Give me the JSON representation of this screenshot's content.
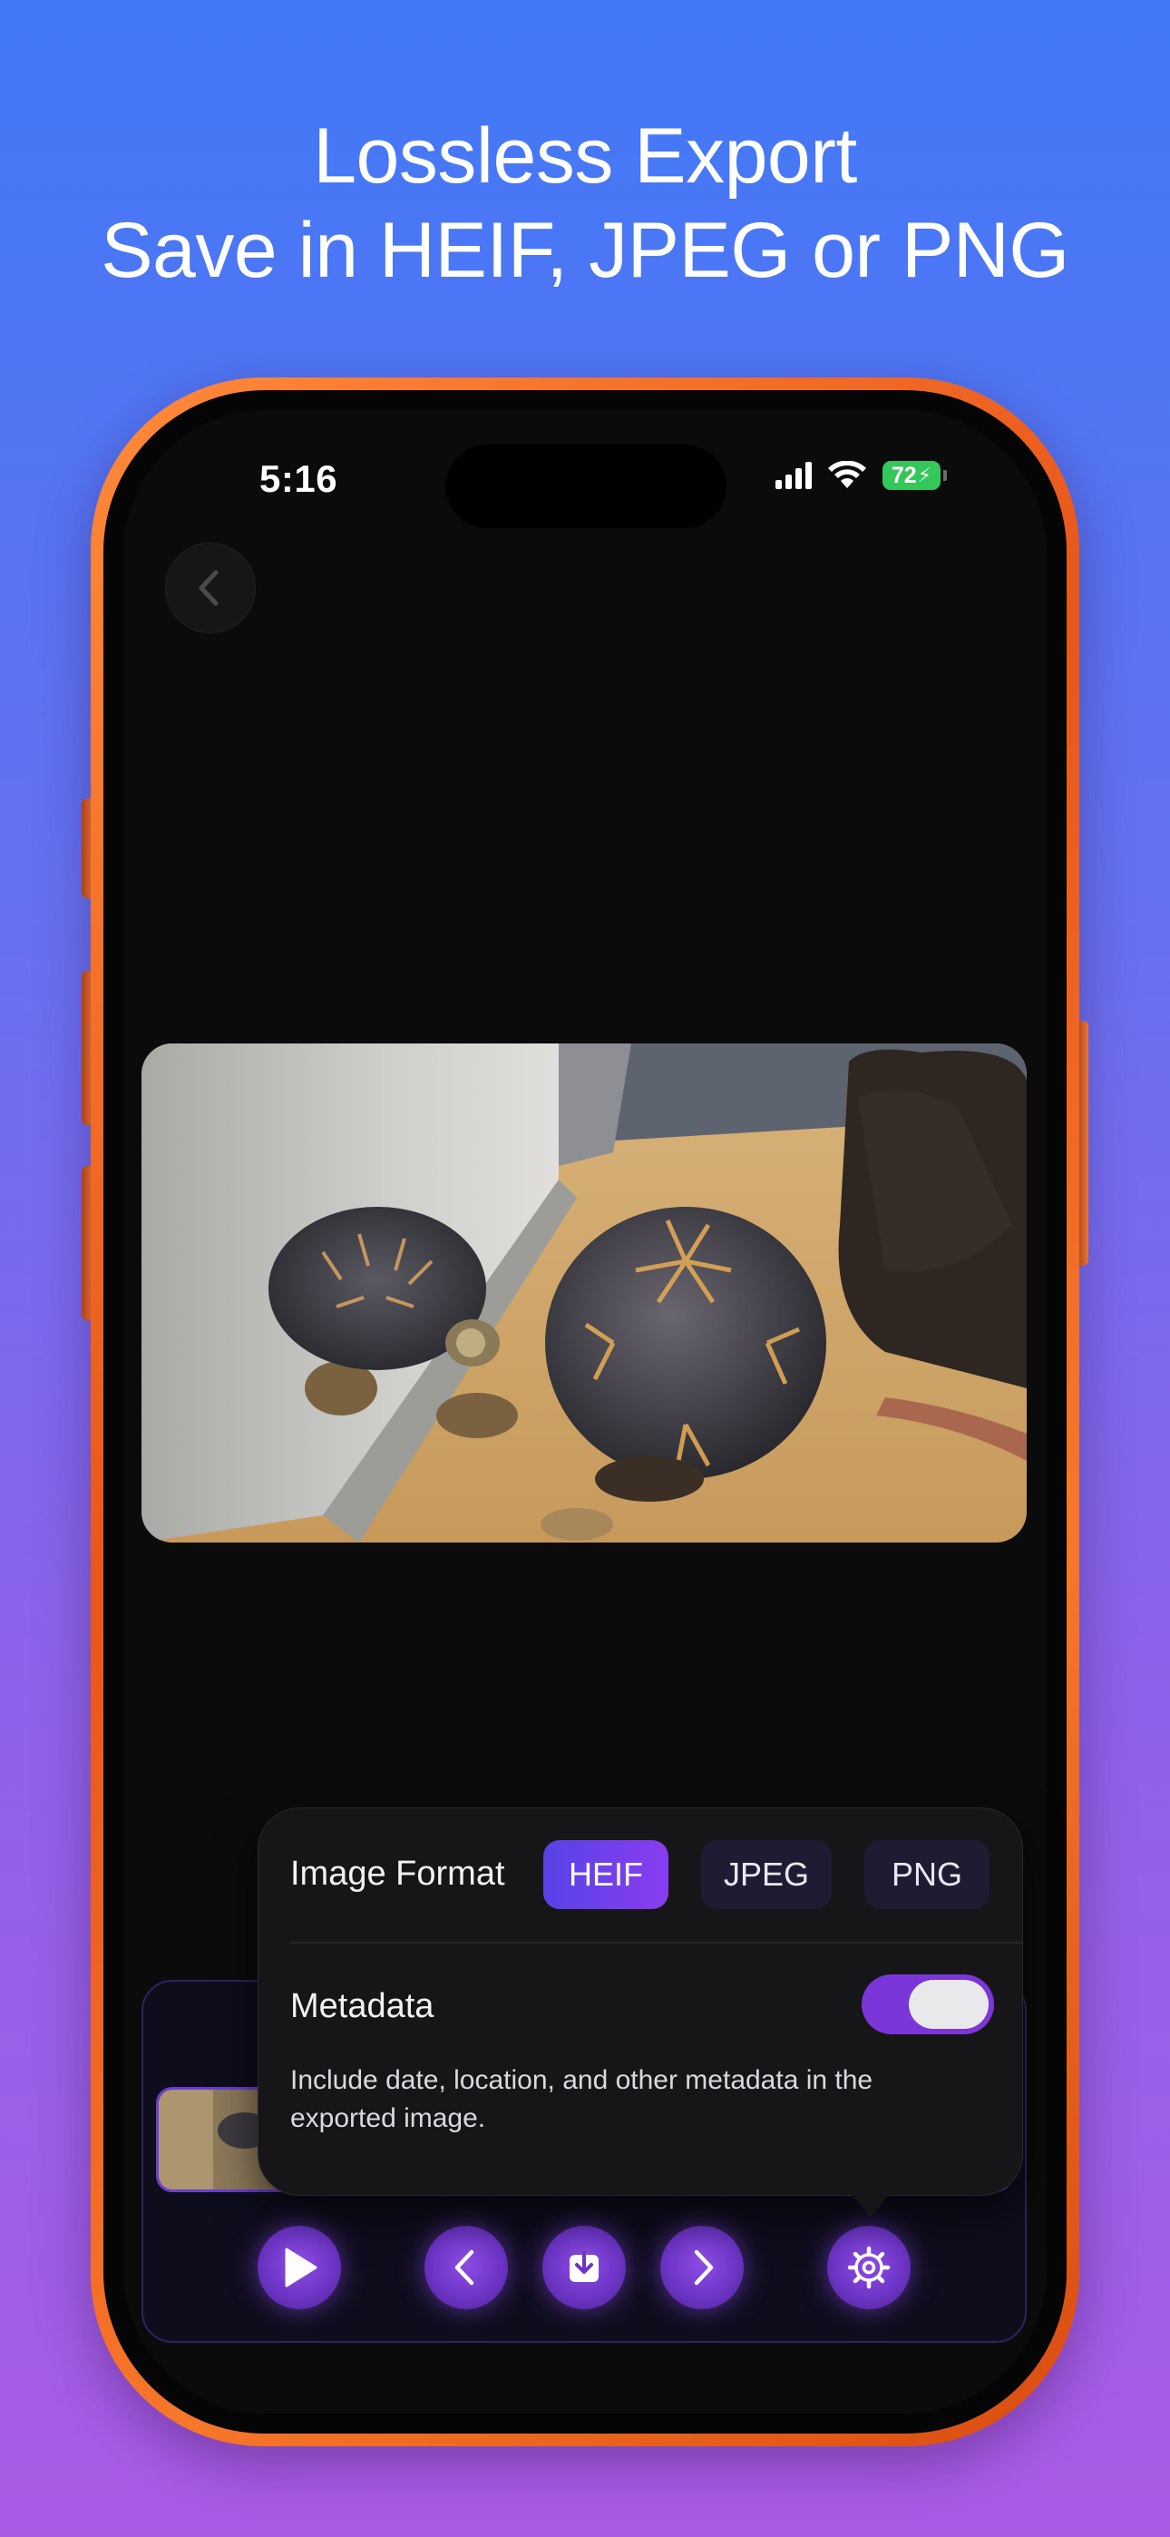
{
  "headline": {
    "line1": "Lossless Export",
    "line2": "Save in HEIF, JPEG or PNG"
  },
  "status_bar": {
    "time": "5:16",
    "battery": "72"
  },
  "popup": {
    "format_label": "Image Format",
    "formats": [
      "HEIF",
      "JPEG",
      "PNG"
    ],
    "selected_format": "HEIF",
    "metadata_label": "Metadata",
    "metadata_enabled": true,
    "metadata_description": "Include date, location, and other metadata in the exported image."
  },
  "colors": {
    "accent": "#7a36d8",
    "selected_segment": "#5643e6",
    "frame": "#f7772a"
  },
  "icons": [
    "chevron-left-icon",
    "play-icon",
    "chevron-left-icon",
    "download-icon",
    "chevron-right-icon",
    "gear-icon"
  ]
}
